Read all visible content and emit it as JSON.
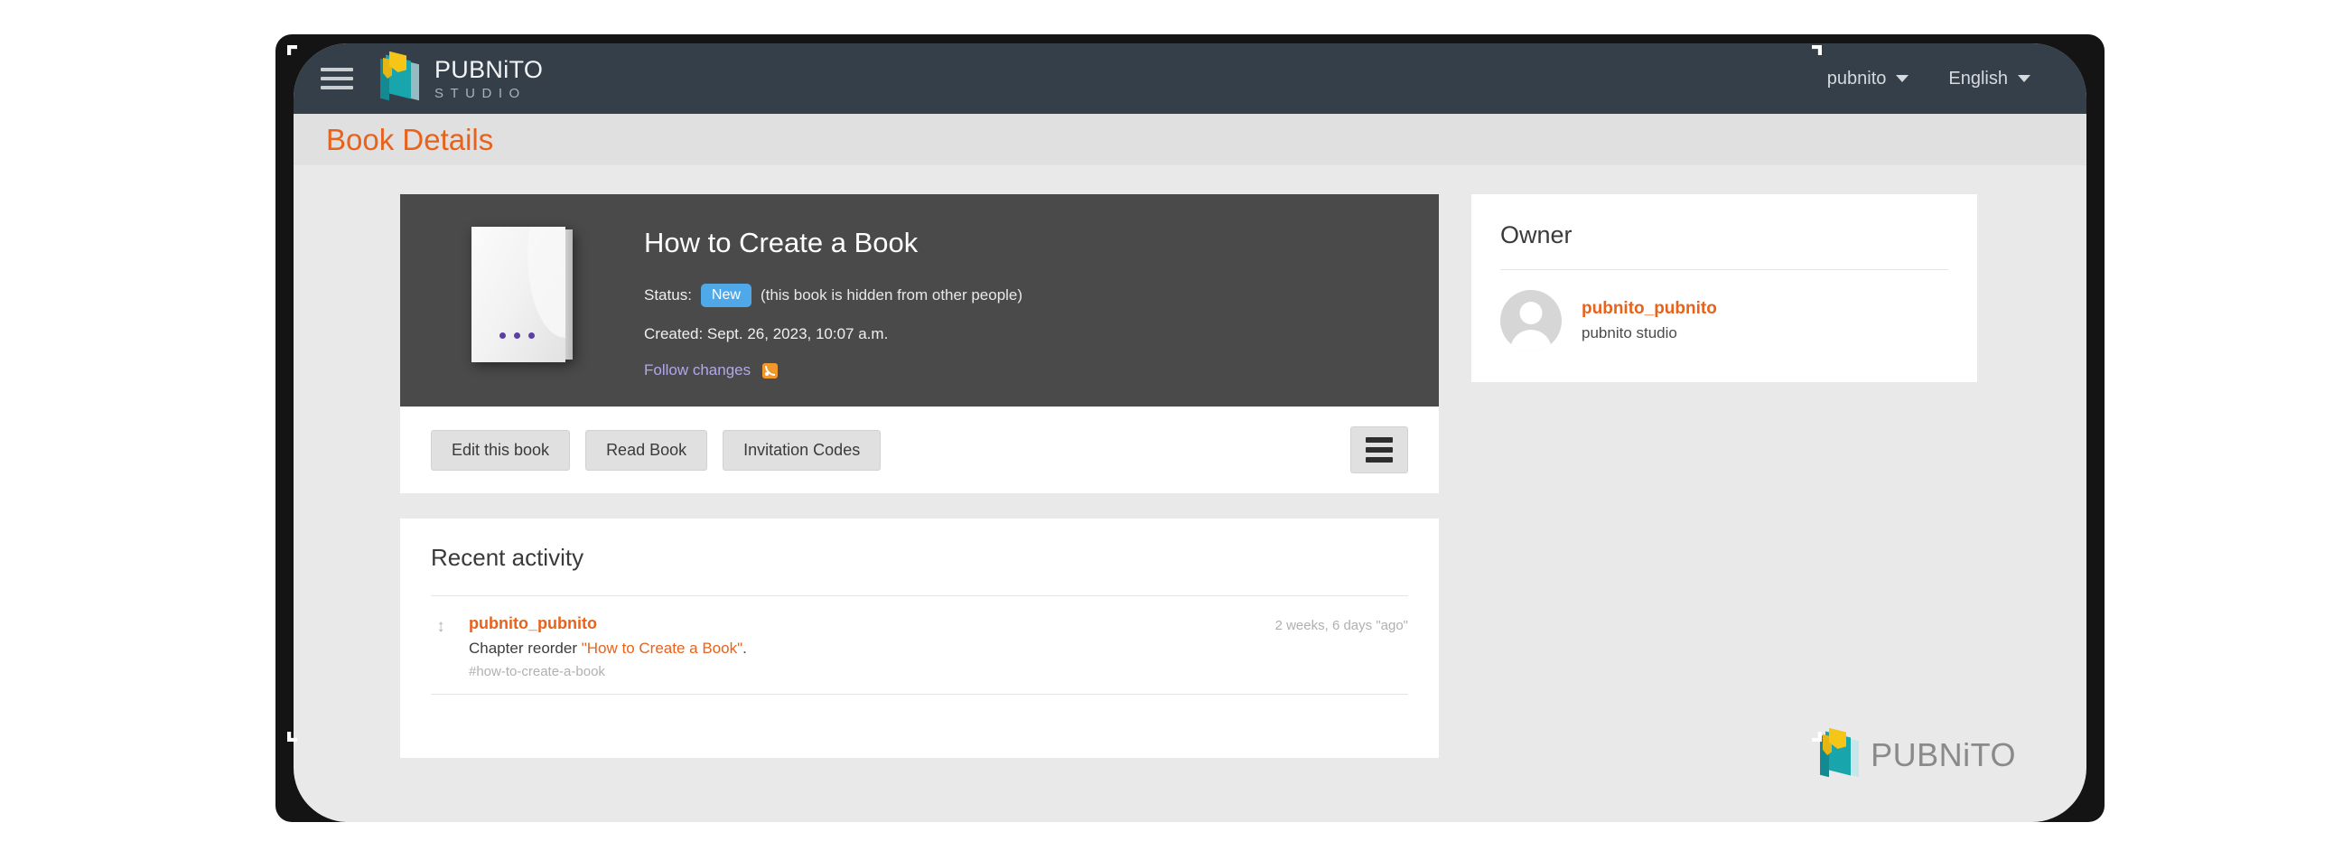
{
  "navbar": {
    "hamburger_icon": "hamburger-menu-icon",
    "brand_main": "PUBNiTO",
    "brand_sub": "STUDIO",
    "user_menu": "pubnito",
    "language_menu": "English",
    "caret_icon": "chevron-down-icon"
  },
  "page": {
    "title": "Book Details"
  },
  "book": {
    "cover_icon": "blank-book-cover",
    "title": "How to Create a Book",
    "status_label": "Status:",
    "status_value": "New",
    "status_note": "(this book is hidden from other people)",
    "created": "Created: Sept. 26, 2023, 10:07 a.m.",
    "follow_label": "Follow changes",
    "rss_icon": "rss-feed-icon"
  },
  "actions": {
    "edit_label": "Edit this book",
    "read_label": "Read Book",
    "invitation_label": "Invitation Codes",
    "overflow_icon": "hamburger-menu-icon"
  },
  "activity": {
    "heading": "Recent activity",
    "items": [
      {
        "icon": "reorder-arrows-icon",
        "user": "pubnito_pubnito",
        "action_prefix": "Chapter reorder ",
        "action_link": "\"How to Create a Book\"",
        "action_suffix": ".",
        "slug": "#how-to-create-a-book",
        "time": "2 weeks, 6 days \"ago\""
      }
    ]
  },
  "owner": {
    "heading": "Owner",
    "avatar_icon": "user-avatar-placeholder",
    "name": "pubnito_pubnito",
    "subtitle": "pubnito studio"
  },
  "watermark": {
    "logo_icon": "pubnito-book-logo",
    "text": "PUBNiTO"
  },
  "colors": {
    "navbar_bg": "#343f4a",
    "accent_orange": "#e8621c",
    "badge_blue": "#4fa8e8",
    "book_card_bg": "#4a4a4a",
    "page_bg": "#e9e9e9",
    "logo_teal": "#18a5ac",
    "logo_yellow": "#f5c518"
  }
}
